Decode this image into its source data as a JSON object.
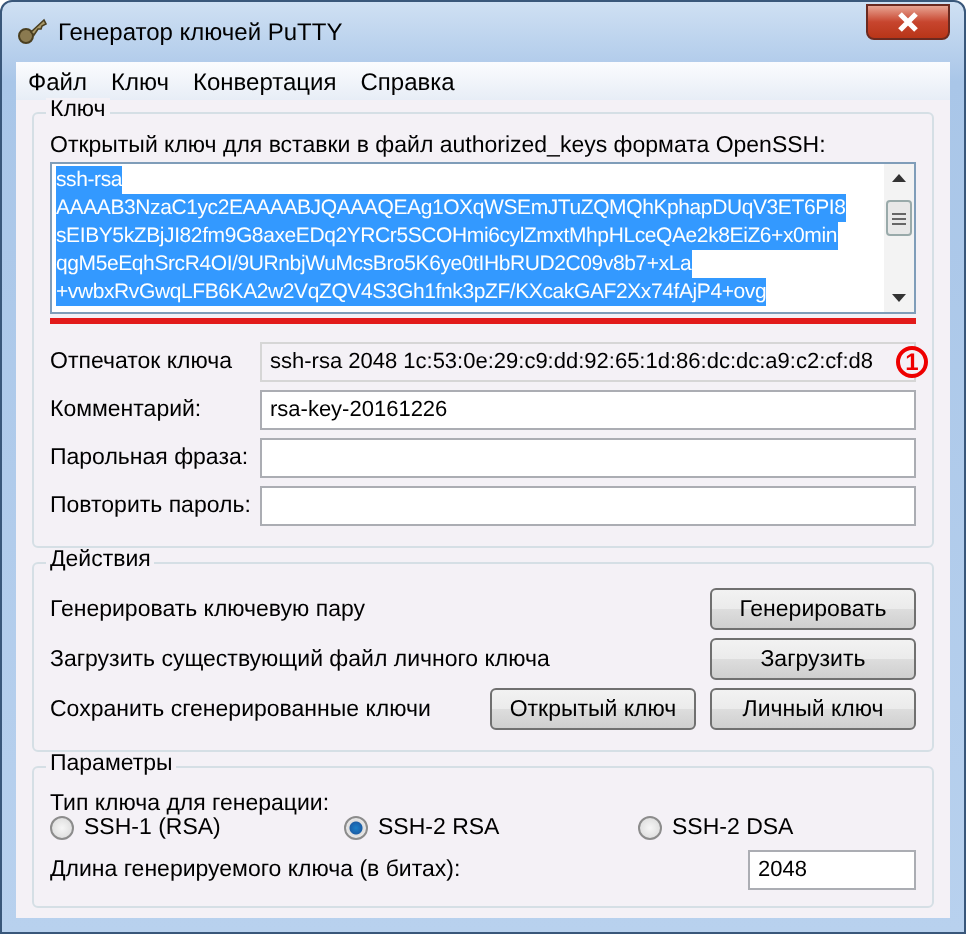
{
  "window": {
    "title": "Генератор ключей PuTTY"
  },
  "menu": [
    {
      "label": "Файл"
    },
    {
      "label": "Ключ"
    },
    {
      "label": "Конвертация"
    },
    {
      "label": "Справка"
    }
  ],
  "key_group": {
    "title": "Ключ",
    "public_key_label": "Открытый ключ для вставки в файл authorized_keys формата OpenSSH:",
    "public_key": {
      "selected": true,
      "lines": [
        "ssh-rsa",
        "AAAAB3NzaC1yc2EAAAABJQAAAQEAg1OXqWSEmJTuZQMQhKphapDUqV3ET6PI8",
        "sEIBY5kZBjJI82fm9G8axeEDq2YRCr5SCOHmi6cylZmxtMhpHLceQAe2k8EiZ6+x0min",
        "qgM5eEqhSrcR4OI/9URnbjWuMcsBro5K6ye0tIHbRUD2C09v8b7+xLa",
        "+vwbxRvGwqLFB6KA2w2VqZQV4S3Gh1fnk3pZF/KXcakGAF2Xx74fAjP4+ovg"
      ]
    },
    "annotation_marker": "1",
    "fields": [
      {
        "label": "Отпечаток ключа",
        "value": "ssh-rsa 2048 1c:53:0e:29:c9:dd:92:65:1d:86:dc:dc:a9:c2:cf:d8",
        "readonly": true
      },
      {
        "label": "Комментарий:",
        "value": "rsa-key-20161226",
        "readonly": false
      },
      {
        "label": "Парольная фраза:",
        "readonly": false
      },
      {
        "label": "Повторить пароль:",
        "readonly": false
      }
    ]
  },
  "actions_group": {
    "title": "Действия",
    "rows": [
      {
        "label": "Генерировать ключевую пару",
        "buttons": [
          "Генерировать"
        ]
      },
      {
        "label": "Загрузить существующий файл личного ключа",
        "buttons": [
          "Загрузить"
        ]
      },
      {
        "label": "Сохранить сгенерированные ключи",
        "buttons": [
          "Открытый ключ",
          "Личный ключ"
        ]
      }
    ]
  },
  "params_group": {
    "title": "Параметры",
    "key_type_label": "Тип ключа для генерации:",
    "key_types": [
      {
        "label": "SSH-1 (RSA)",
        "selected": false
      },
      {
        "label": "SSH-2 RSA",
        "selected": true
      },
      {
        "label": "SSH-2 DSA",
        "selected": false
      }
    ],
    "bits_label": "Длина генерируемого ключа (в битах):",
    "bits_value": "2048"
  }
}
